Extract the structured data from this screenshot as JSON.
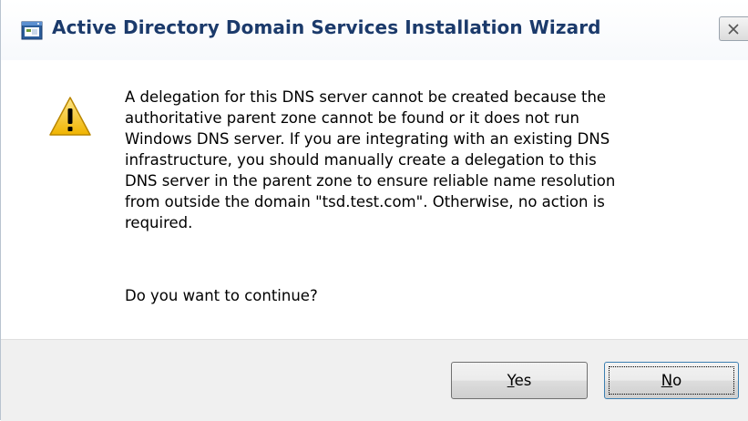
{
  "window": {
    "title": "Active Directory Domain Services Installation Wizard",
    "app_icon": "window-app-icon",
    "close_icon": "close-x-icon"
  },
  "dialog": {
    "icon": "warning-icon",
    "message_lines": [
      "A delegation for this DNS server cannot be created because the",
      "authoritative parent zone cannot be found or it does not run",
      "Windows DNS server. If you are integrating with an existing DNS",
      "infrastructure, you should manually create a delegation to this",
      "DNS server in the parent zone to ensure reliable name resolution",
      "from outside the domain \"tsd.test.com\". Otherwise, no action is",
      "required."
    ],
    "question": "Do you want to continue?"
  },
  "buttons": {
    "yes": {
      "accel": "Y",
      "rest": "es"
    },
    "no": {
      "accel": "N",
      "rest": "o"
    }
  },
  "colors": {
    "title_text": "#1b3a6b",
    "footer_bg": "#f0f0f0",
    "warning_yellow": "#f5c518"
  }
}
